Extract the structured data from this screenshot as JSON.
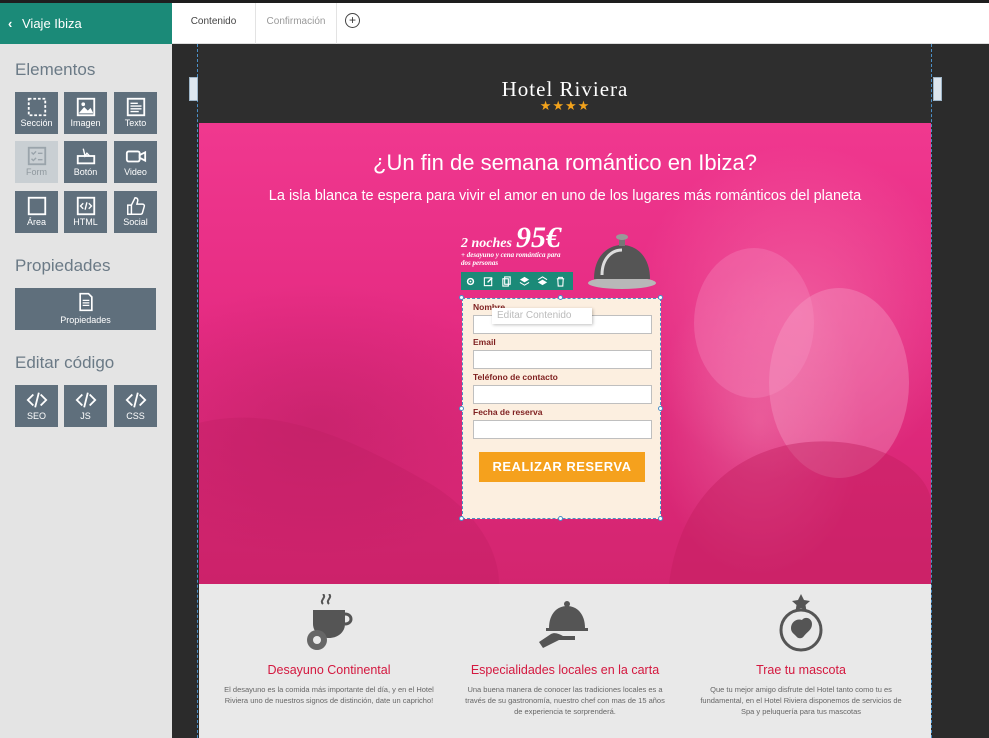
{
  "back_button": {
    "label": "Viaje Ibiza"
  },
  "sidebar": {
    "elements_title": "Elementos",
    "elements": [
      {
        "label": "Sección",
        "icon": "section-icon"
      },
      {
        "label": "Imagen",
        "icon": "image-icon"
      },
      {
        "label": "Texto",
        "icon": "text-icon"
      },
      {
        "label": "Form",
        "icon": "form-icon",
        "disabled": true
      },
      {
        "label": "Botón",
        "icon": "button-icon"
      },
      {
        "label": "Video",
        "icon": "video-icon"
      },
      {
        "label": "Área",
        "icon": "area-icon"
      },
      {
        "label": "HTML",
        "icon": "html-icon"
      },
      {
        "label": "Social",
        "icon": "thumbs-up-icon"
      }
    ],
    "properties_title": "Propiedades",
    "properties_button": {
      "label": "Propiedades",
      "icon": "document-icon"
    },
    "code_title": "Editar código",
    "code_buttons": [
      {
        "label": "SEO",
        "icon": "code-icon"
      },
      {
        "label": "JS",
        "icon": "code-icon"
      },
      {
        "label": "CSS",
        "icon": "code-icon"
      }
    ]
  },
  "tabs": [
    {
      "label": "Contenido",
      "active": true
    },
    {
      "label": "Confirmación",
      "active": false
    }
  ],
  "page": {
    "brand": "Hotel Riviera",
    "stars": "★★★★",
    "hero_title": "¿Un fin de semana romántico en Ibiza?",
    "hero_subtitle": "La isla blanca te espera para vivir el amor en uno de los lugares más románticos del planeta",
    "offer": {
      "nights": "2 noches",
      "price": "95€",
      "detail": "+ desayuno y cena romántica para dos personas"
    },
    "form": {
      "tooltip": "Editar Contenido",
      "fields": [
        {
          "label": "Nombre"
        },
        {
          "label": "Email"
        },
        {
          "label": "Teléfono de contacto"
        },
        {
          "label": "Fecha de reserva"
        }
      ],
      "submit_label": "REALIZAR RESERVA"
    },
    "features": [
      {
        "title": "Desayuno Continental",
        "text": "El desayuno es la comida más importante del día, y en el Hotel Riviera uno de nuestros signos de distinción, date un capricho!",
        "icon": "coffee-cup-icon"
      },
      {
        "title": "Especialidades locales en la carta",
        "text": "Una buena manera de conocer las tradiciones locales es a través de su gastronomía, nuestro chef con mas de 15 años de experiencia te sorprenderá.",
        "icon": "serving-cloche-icon"
      },
      {
        "title": "Trae tu mascota",
        "text": "Que tu mejor amigo disfrute del Hotel tanto como tu es fundamental, en el Hotel Riviera disponemos de servicios de Spa y peluquería para tus mascotas",
        "icon": "pet-badge-icon"
      }
    ]
  },
  "colors": {
    "accent": "#1b8a78",
    "tile": "#5f6f7c",
    "hero": "#e52b82",
    "button": "#f5a11d",
    "feature_title": "#d4183f"
  }
}
